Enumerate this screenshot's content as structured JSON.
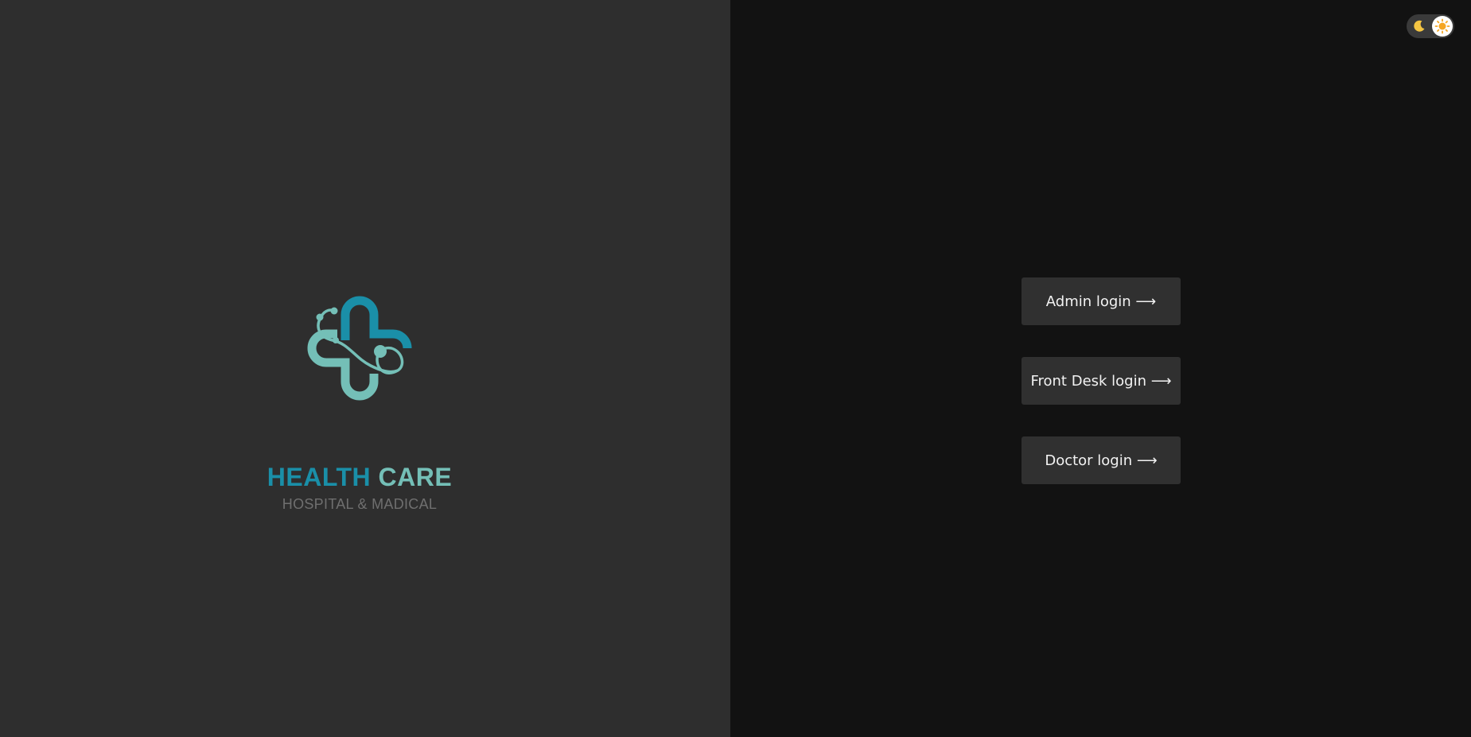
{
  "brand": {
    "title_part1": "HEALTH",
    "title_part2": "CARE",
    "subtitle": "HOSPITAL & MADICAL",
    "logo_icon": "medical-cross-stethoscope-icon",
    "colors": {
      "primary": "#1a8fa8",
      "secondary": "#74bfb7",
      "subtitle": "#6f6f6f"
    }
  },
  "login": {
    "buttons": [
      {
        "label": "Admin login ⟶"
      },
      {
        "label": "Front Desk login ⟶"
      },
      {
        "label": "Doctor login ⟶"
      }
    ]
  },
  "theme_toggle": {
    "left_icon": "moon-icon",
    "right_icon": "sun-icon",
    "active": "dark"
  },
  "colors": {
    "left_panel_bg": "#2e2e2e",
    "right_panel_bg": "#121212",
    "button_bg": "#303030",
    "button_text": "#f2f2f2"
  }
}
